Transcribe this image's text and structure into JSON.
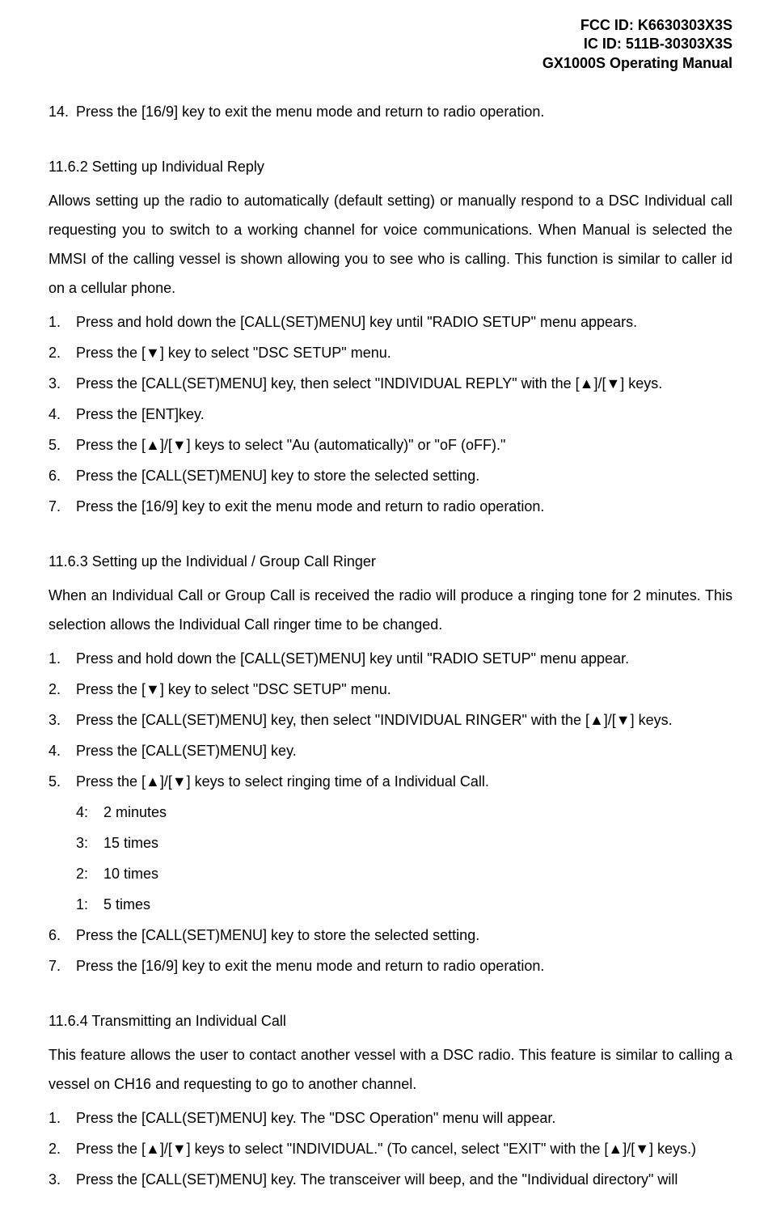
{
  "header": {
    "fcc": "FCC ID: K6630303X3S",
    "ic": "IC ID: 511B-30303X3S",
    "title": "GX1000S Operating Manual"
  },
  "intro_step": {
    "num": "14.",
    "text": "Press the [16/9] key to exit the menu mode and return to radio operation."
  },
  "sec_11_6_2": {
    "heading": "11.6.2    Setting up Individual Reply",
    "para": "Allows setting up the radio to automatically (default setting) or manually respond to a DSC Individual call requesting you to switch to a working channel for voice communications. When Manual is selected the MMSI of the calling vessel is shown allowing you to see who is calling. This function is similar to caller id on a cellular phone.",
    "steps": [
      {
        "n": "1.",
        "t": "Press and hold down the [CALL(SET)MENU] key until \"RADIO SETUP\" menu appears."
      },
      {
        "n": "2.",
        "t": "Press the [▼] key to select \"DSC SETUP\" menu."
      },
      {
        "n": "3.",
        "t": "Press the [CALL(SET)MENU] key, then select \"INDIVIDUAL REPLY\" with the [▲]/[▼] keys."
      },
      {
        "n": "4.",
        "t": "Press the [ENT]key."
      },
      {
        "n": "5.",
        "t": "Press the [▲]/[▼] keys to select \"Au (automatically)\" or \"oF (oFF).\""
      },
      {
        "n": "6.",
        "t": "Press the [CALL(SET)MENU] key to store the selected setting."
      },
      {
        "n": "7.",
        "t": "Press the [16/9] key to exit the menu mode and return to radio operation."
      }
    ]
  },
  "sec_11_6_3": {
    "heading": "11.6.3    Setting up the Individual / Group Call Ringer",
    "para": "When an Individual Call or Group Call is received the radio will produce a ringing tone for 2 minutes. This selection allows the Individual Call ringer time to be changed.",
    "steps": [
      {
        "n": "1.",
        "t": "Press and hold down the [CALL(SET)MENU] key until \"RADIO SETUP\" menu appear."
      },
      {
        "n": "2.",
        "t": "Press the [▼] key to select \"DSC SETUP\" menu."
      },
      {
        "n": "3.",
        "t": "Press the [CALL(SET)MENU] key, then select \"INDIVIDUAL RINGER\" with the [▲]/[▼] keys."
      },
      {
        "n": "4.",
        "t": "Press the [CALL(SET)MENU] key."
      },
      {
        "n": "5.",
        "t": "Press the [▲]/[▼] keys to select ringing time of a Individual Call."
      }
    ],
    "sub": [
      {
        "n": "4:",
        "t": "2 minutes"
      },
      {
        "n": "3:",
        "t": "15 times"
      },
      {
        "n": "2:",
        "t": "10 times"
      },
      {
        "n": "1:",
        "t": "5 times"
      }
    ],
    "steps_tail": [
      {
        "n": "6.",
        "t": "Press the [CALL(SET)MENU] key to store the selected setting."
      },
      {
        "n": "7.",
        "t": "Press the [16/9] key to exit the menu mode and return to radio operation."
      }
    ]
  },
  "sec_11_6_4": {
    "heading": "11.6.4    Transmitting an Individual Call",
    "para": "This feature allows the user to contact another vessel with a DSC radio. This feature is similar to calling a vessel on CH16 and requesting to go to another channel.",
    "steps": [
      {
        "n": "1.",
        "t": "Press the [CALL(SET)MENU] key. The \"DSC Operation\" menu will appear."
      },
      {
        "n": "2.",
        "t": "Press the [▲]/[▼] keys to select \"INDIVIDUAL.\" (To cancel, select \"EXIT\" with the [▲]/[▼] keys.)"
      },
      {
        "n": "3.",
        "t": "Press the [CALL(SET)MENU] key. The transceiver will beep, and the \"Individual directory\" will"
      }
    ]
  }
}
